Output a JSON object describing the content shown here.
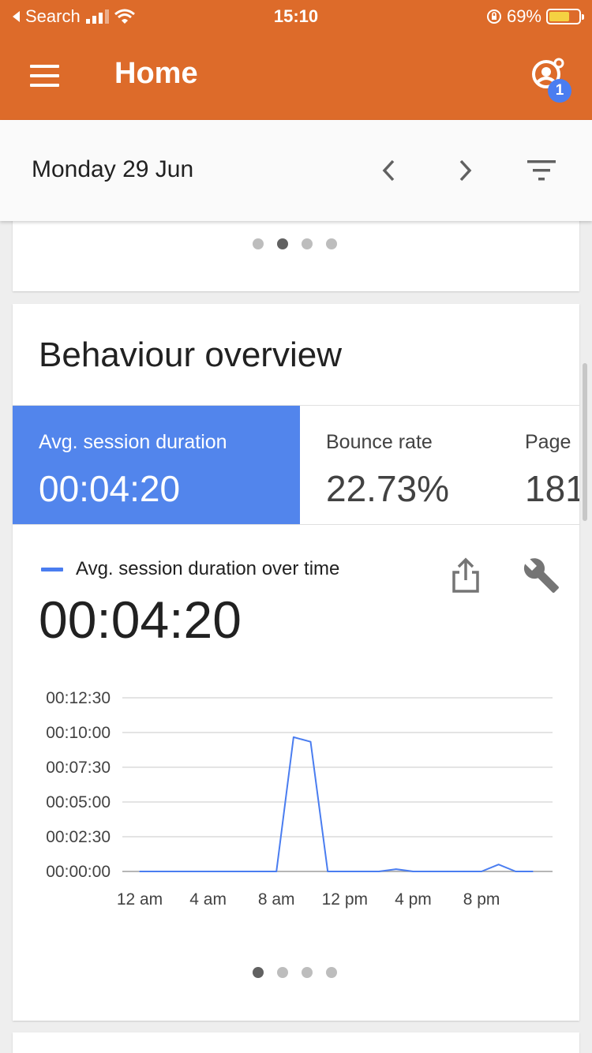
{
  "status_bar": {
    "back_label": "Search",
    "time": "15:10",
    "battery": "69%",
    "battery_level": 0.69
  },
  "app_bar": {
    "title": "Home",
    "notification_count": "1",
    "color": "#dd6b2a"
  },
  "date_bar": {
    "date": "Monday 29 Jun"
  },
  "top_card": {
    "pages": 4,
    "active_page": 1
  },
  "behaviour_card": {
    "title": "Behaviour overview",
    "tabs": [
      {
        "label": "Avg. session duration",
        "value": "00:04:20",
        "selected": true
      },
      {
        "label": "Bounce rate",
        "value": "22.73%",
        "selected": false
      },
      {
        "label": "Page",
        "value": "181",
        "selected": false
      }
    ],
    "legend_label": "Avg. session duration over time",
    "big_value": "00:04:20",
    "pages": 4,
    "active_page": 0
  },
  "chart_data": {
    "type": "line",
    "title": "",
    "xlabel": "",
    "ylabel": "",
    "series": [
      {
        "color": "#4a7df0",
        "x": [
          0,
          1,
          2,
          3,
          4,
          5,
          6,
          7,
          8,
          9,
          10,
          11,
          12,
          13,
          14,
          15,
          16,
          17,
          18,
          19,
          20,
          21,
          22,
          23
        ],
        "values": [
          0,
          0,
          0,
          0,
          0,
          0,
          0,
          0,
          0,
          580,
          560,
          0,
          0,
          0,
          0,
          10,
          0,
          0,
          0,
          0,
          0,
          30,
          0,
          0
        ]
      }
    ],
    "x_ticks": [
      {
        "x": 0,
        "label": "12 am"
      },
      {
        "x": 4,
        "label": "4 am"
      },
      {
        "x": 8,
        "label": "8 am"
      },
      {
        "x": 12,
        "label": "12 pm"
      },
      {
        "x": 16,
        "label": "4 pm"
      },
      {
        "x": 20,
        "label": "8 pm"
      }
    ],
    "y_ticks": [
      {
        "y": 0,
        "label": "00:00:00"
      },
      {
        "y": 150,
        "label": "00:02:30"
      },
      {
        "y": 300,
        "label": "00:05:00"
      },
      {
        "y": 450,
        "label": "00:07:30"
      },
      {
        "y": 600,
        "label": "00:10:00"
      },
      {
        "y": 750,
        "label": "00:12:30"
      }
    ],
    "y_unit": "seconds",
    "ylim": [
      0,
      750
    ],
    "xlim": [
      0,
      23
    ],
    "grid": true
  }
}
